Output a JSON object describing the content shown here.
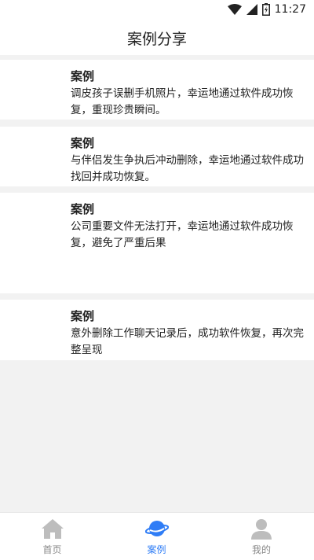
{
  "status_bar": {
    "time": "11:27"
  },
  "header": {
    "title": "案例分享"
  },
  "cases": [
    {
      "title": "案例",
      "desc": "调皮孩子误删手机照片，幸运地通过软件成功恢复，重现珍贵瞬间。"
    },
    {
      "title": "案例",
      "desc": "与伴侣发生争执后冲动删除，幸运地通过软件成功找回并成功恢复。"
    },
    {
      "title": "案例",
      "desc": "公司重要文件无法打开，幸运地通过软件成功恢复，避免了严重后果"
    },
    {
      "title": "案例",
      "desc": "意外删除工作聊天记录后，成功软件恢复，再次完整呈现"
    }
  ],
  "tabs": [
    {
      "label": "首页",
      "icon": "home-icon"
    },
    {
      "label": "案例",
      "icon": "planet-icon"
    },
    {
      "label": "我的",
      "icon": "user-icon"
    }
  ],
  "colors": {
    "accent": "#2f7df6",
    "inactive": "#bdbdbd",
    "background": "#f2f2f2"
  }
}
